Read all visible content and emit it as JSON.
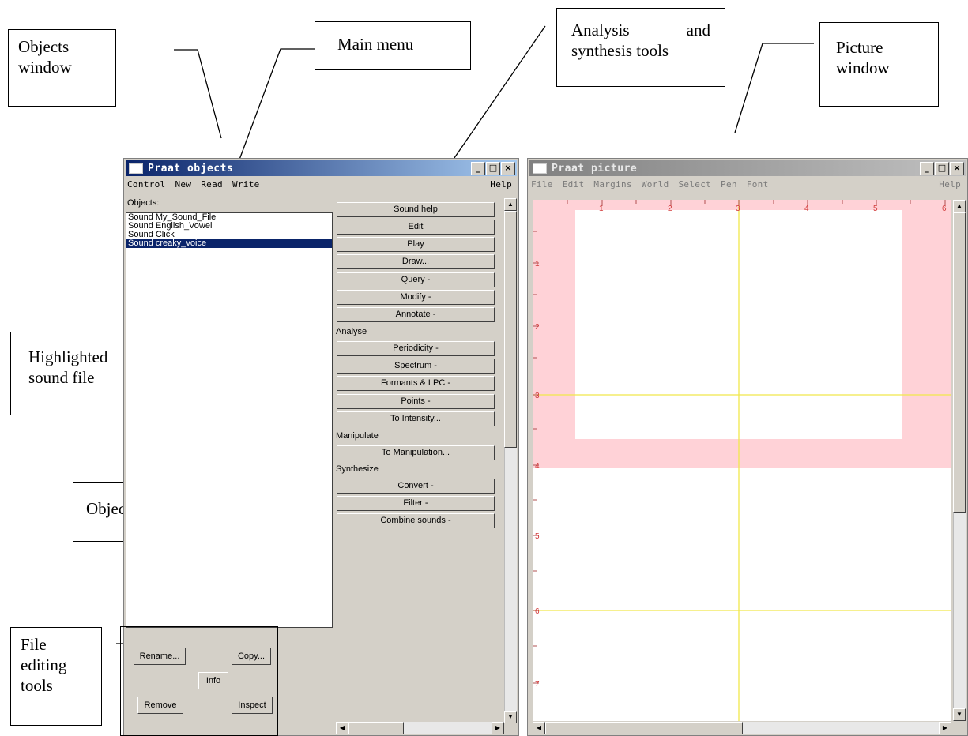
{
  "annotations": {
    "objects_window": "Objects\nwindow",
    "main_menu": "Main menu",
    "analysis_tools": "Analysis and synthesis tools",
    "picture_window": "Picture\nwindow",
    "highlighted_sound": "Highlighted\nsound file",
    "objects_list": "Objects list",
    "file_editing_tools": "File\nediting\ntools"
  },
  "objects_window": {
    "title": "Praat objects",
    "menu": [
      "Control",
      "New",
      "Read",
      "Write"
    ],
    "help": "Help",
    "objects_label": "Objects:",
    "list": [
      {
        "text": "Sound My_Sound_File",
        "selected": false
      },
      {
        "text": "Sound English_Vowel",
        "selected": false
      },
      {
        "text": "Sound Click",
        "selected": false
      },
      {
        "text": "Sound creaky_voice",
        "selected": true
      }
    ],
    "buttons_top": [
      "Sound help",
      "Edit",
      "Play",
      "Draw...",
      "Query -",
      "Modify -",
      "Annotate -"
    ],
    "analyse_label": "Analyse",
    "buttons_analyse": [
      "Periodicity -",
      "Spectrum -",
      "Formants & LPC -",
      "Points -",
      "To Intensity..."
    ],
    "manipulate_label": "Manipulate",
    "buttons_manipulate": [
      "To Manipulation..."
    ],
    "synthesize_label": "Synthesize",
    "buttons_synthesize": [
      "Convert -",
      "Filter -",
      "Combine sounds -"
    ],
    "edit_buttons": {
      "rename": "Rename...",
      "copy": "Copy...",
      "info": "Info",
      "remove": "Remove",
      "inspect": "Inspect"
    }
  },
  "picture_window": {
    "title": "Praat picture",
    "menu": [
      "File",
      "Edit",
      "Margins",
      "World",
      "Select",
      "Pen",
      "Font"
    ],
    "help": "Help",
    "ruler_top": [
      "1",
      "2",
      "3",
      "4",
      "5",
      "6"
    ],
    "ruler_left": [
      "1",
      "2",
      "3",
      "4",
      "5",
      "6",
      "7"
    ]
  },
  "window_controls": {
    "minimize": "_",
    "maximize": "□",
    "close": "×"
  },
  "colors": {
    "active_title": "#0a246a",
    "inactive_title": "#808080",
    "selection_pink": "#ffd2d7",
    "guide_yellow": "#f0e84a",
    "ruler_red": "#d23c3c"
  }
}
